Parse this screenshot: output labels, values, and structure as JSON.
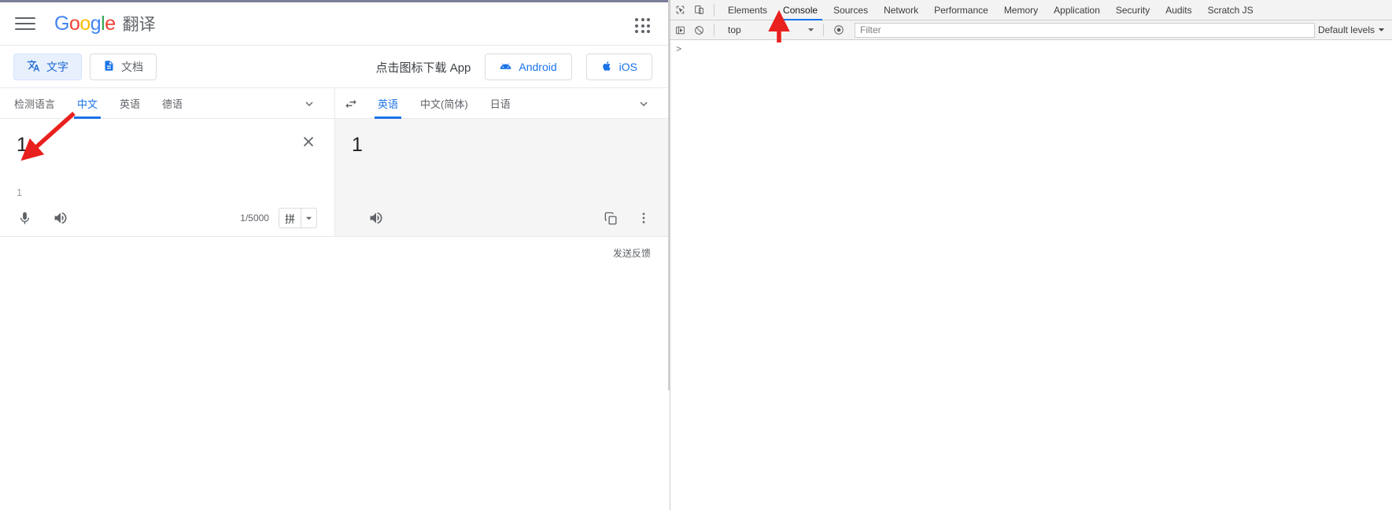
{
  "translate": {
    "brand": {
      "g1": "G",
      "o1": "o",
      "o2": "o",
      "g2": "g",
      "l": "l",
      "e": "e",
      "product": "翻译"
    },
    "menu_icon": "hamburger-icon",
    "apps_icon": "apps-grid-icon",
    "modes": [
      {
        "label": "文字",
        "icon": "translate-icon",
        "active": true
      },
      {
        "label": "文档",
        "icon": "document-icon",
        "active": false
      }
    ],
    "download": {
      "label": "点击图标下载 App",
      "buttons": [
        {
          "label": "Android",
          "icon": "android-icon"
        },
        {
          "label": "iOS",
          "icon": "apple-icon"
        }
      ]
    },
    "source": {
      "tabs": [
        {
          "label": "检测语言",
          "active": false
        },
        {
          "label": "中文",
          "active": true
        },
        {
          "label": "英语",
          "active": false
        },
        {
          "label": "德语",
          "active": false
        }
      ],
      "more_icon": "chevron-down-icon",
      "text": "1",
      "pinyin": "1",
      "counter": "1/5000",
      "clear_icon": "close-icon",
      "mic_icon": "microphone-icon",
      "speaker_icon": "speaker-icon",
      "pinyin_button": {
        "label": "拼",
        "arrow_icon": "dropdown-arrow-icon"
      }
    },
    "swap_icon": "swap-languages-icon",
    "target": {
      "tabs": [
        {
          "label": "英语",
          "active": true
        },
        {
          "label": "中文(简体)",
          "active": false
        },
        {
          "label": "日语",
          "active": false
        }
      ],
      "more_icon": "chevron-down-icon",
      "text": "1",
      "speaker_icon": "speaker-icon",
      "copy_icon": "copy-icon",
      "more_options_icon": "more-vertical-icon"
    },
    "feedback": "发送反馈",
    "colors": {
      "accent_blue": "#1a73e8",
      "chip_active_bg": "#e8f0fe",
      "target_bg": "#f5f5f5",
      "annotation_red": "#e8201e"
    }
  },
  "devtools": {
    "left_icons": [
      {
        "name": "inspect-element-icon"
      },
      {
        "name": "device-toolbar-icon"
      }
    ],
    "tabs": [
      {
        "label": "Elements",
        "active": false
      },
      {
        "label": "Console",
        "active": true
      },
      {
        "label": "Sources",
        "active": false
      },
      {
        "label": "Network",
        "active": false
      },
      {
        "label": "Performance",
        "active": false
      },
      {
        "label": "Memory",
        "active": false
      },
      {
        "label": "Application",
        "active": false
      },
      {
        "label": "Security",
        "active": false
      },
      {
        "label": "Audits",
        "active": false
      },
      {
        "label": "Scratch JS",
        "active": false
      }
    ],
    "console_toolbar": {
      "execute_icon": "execute-snippet-icon",
      "clear_icon": "clear-console-icon",
      "context": "top",
      "context_arrow_icon": "dropdown-arrow-icon",
      "eye_icon": "live-expression-icon",
      "filter_placeholder": "Filter",
      "levels_label": "Default levels",
      "levels_arrow_icon": "dropdown-arrow-icon"
    },
    "prompt": ">"
  },
  "annotations": [
    {
      "name": "arrow-to-source-input",
      "color": "#e8201e"
    },
    {
      "name": "arrow-to-console-context",
      "color": "#e8201e"
    }
  ]
}
